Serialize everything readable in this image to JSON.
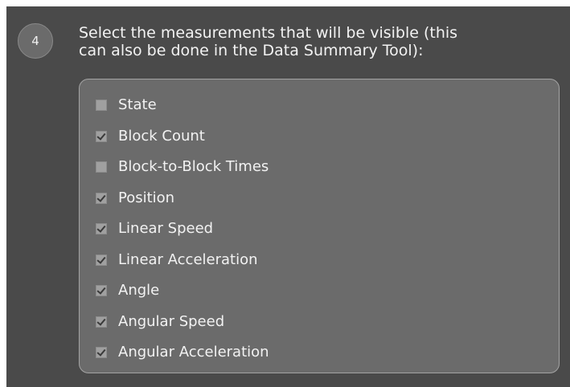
{
  "step": {
    "number": "4",
    "instruction": "Select the measurements that will be visible (this\ncan also be done in the Data Summary Tool):"
  },
  "measurements": [
    {
      "label": "State",
      "checked": false
    },
    {
      "label": "Block Count",
      "checked": true
    },
    {
      "label": "Block-to-Block Times",
      "checked": false
    },
    {
      "label": "Position",
      "checked": true
    },
    {
      "label": "Linear Speed",
      "checked": true
    },
    {
      "label": "Linear Acceleration",
      "checked": true
    },
    {
      "label": "Angle",
      "checked": true
    },
    {
      "label": "Angular Speed",
      "checked": true
    },
    {
      "label": "Angular Acceleration",
      "checked": true
    }
  ],
  "colors": {
    "panel_background": "#4a4a4a",
    "list_background": "#6b6b6b",
    "text": "#f2f2f2",
    "checkbox": "#a0a0a0"
  }
}
